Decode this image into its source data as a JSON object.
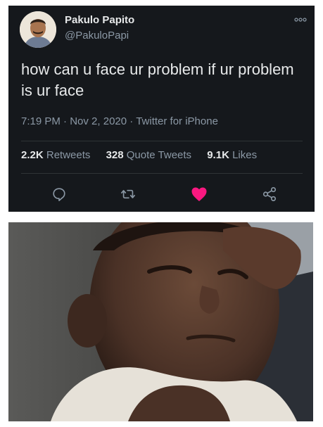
{
  "tweet": {
    "display_name": "Pakulo Papito",
    "handle": "@PakuloPapi",
    "text": "how can u face ur problem if ur problem is ur face",
    "time": "7:19 PM",
    "date": "Nov 2, 2020",
    "source": "Twitter for iPhone",
    "separator": "·",
    "stats": {
      "retweets_count": "2.2K",
      "retweets_label": "Retweets",
      "quote_count": "328",
      "quote_label": "Quote Tweets",
      "likes_count": "9.1K",
      "likes_label": "Likes"
    },
    "icons": [
      "more-icon",
      "reply-icon",
      "retweet-icon",
      "like-icon",
      "share-icon"
    ],
    "colors": {
      "background": "#15181c",
      "text": "#e7e9ea",
      "muted": "#8b98a5",
      "like": "#f91880"
    }
  }
}
